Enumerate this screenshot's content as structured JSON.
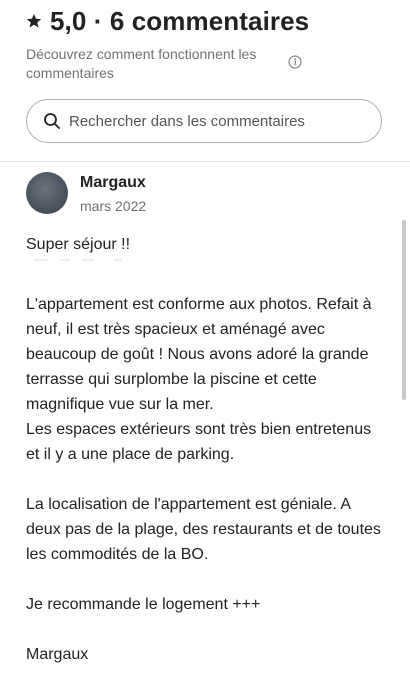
{
  "header": {
    "title": "5,0 · 6 commentaires",
    "icon": "star-icon"
  },
  "info": {
    "text": "Découvrez comment fonctionnent les commentaires",
    "icon": "info-icon"
  },
  "search": {
    "placeholder": "Rechercher dans les commentaires",
    "icon": "search-icon"
  },
  "review": {
    "author": "Margaux",
    "date": "mars 2022",
    "paragraphs": [
      "Super séjour !!",
      "L'appartement est conforme aux photos. Refait à neuf, il est très spacieux et aménagé avec beaucoup de goût ! Nous avons adoré la grande terrasse qui surplombe la piscine et cette magnifique vue sur la mer.\nLes espaces extérieurs sont très bien entretenus et il y a une place de parking.",
      "La localisation de l'appartement est géniale. A deux pas de la plage, des restaurants et de toutes les commodités de la BO.",
      "Je recommande le logement +++",
      "Margaux"
    ]
  },
  "colors": {
    "text": "#222222",
    "muted": "#717171",
    "border": "#b0b0b0",
    "avatar": "#4c5560"
  }
}
